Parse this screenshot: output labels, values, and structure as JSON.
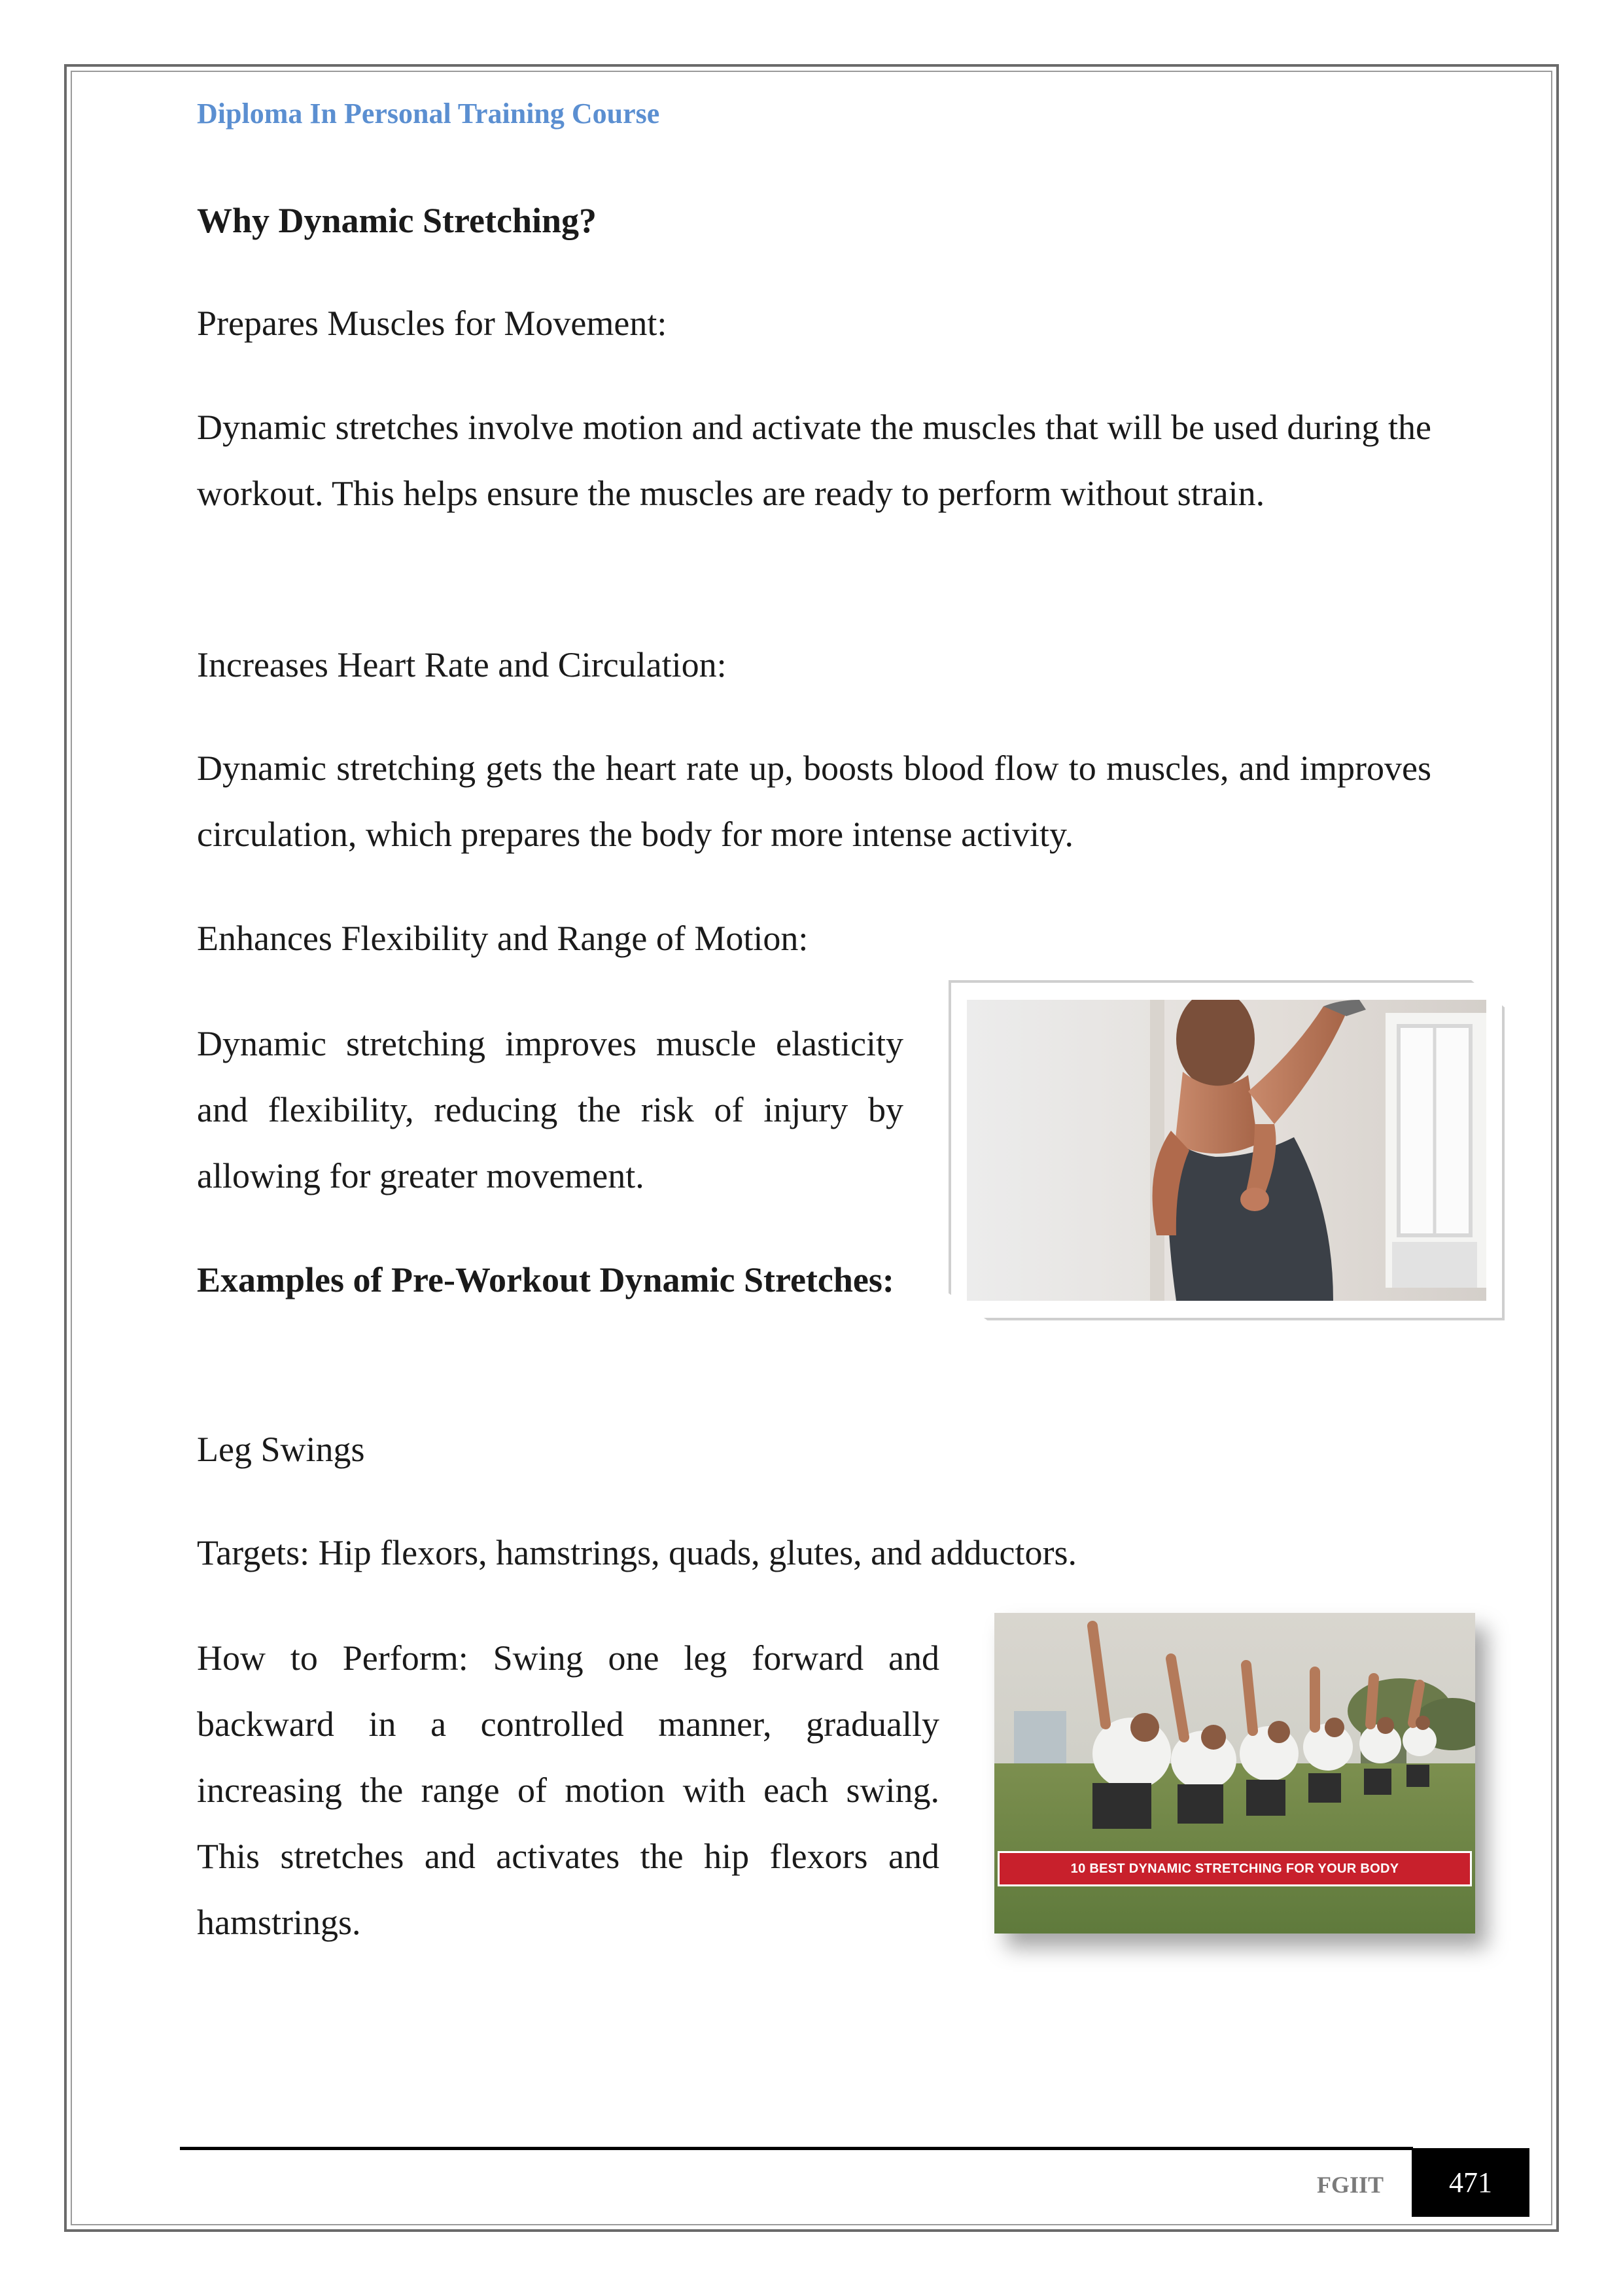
{
  "header": {
    "course_title": "Diploma In Personal Training Course"
  },
  "content": {
    "heading_why": "Why Dynamic Stretching?",
    "sub1": "Prepares Muscles for Movement:",
    "para1": "Dynamic stretches involve motion and activate the muscles that will be used during the workout. This helps ensure the muscles are ready to perform without strain.",
    "sub2": "Increases Heart Rate and Circulation:",
    "para2": "Dynamic stretching gets the heart rate up, boosts blood flow to muscles, and improves circulation, which prepares the body for more intense activity.",
    "sub3": "Enhances Flexibility and Range of Motion:",
    "para3": "Dynamic stretching improves muscle elasticity and flexibility, reducing the risk of injury by allowing for greater movement.",
    "heading_examples": "Examples of Pre-Workout Dynamic Stretches:",
    "ex1_title": "Leg Swings",
    "ex1_targets": "Targets: Hip flexors, hamstrings, quads, glutes, and adductors.",
    "ex1_how": "How to Perform: Swing one leg forward and backward in a controlled manner, gradually increasing the range of motion with each swing. This stretches and activates the hip flexors and hamstrings."
  },
  "images": {
    "banner_text": "10 BEST DYNAMIC STRETCHING FOR YOUR BODY"
  },
  "footer": {
    "org": "FGIIT",
    "page_number": "471"
  }
}
